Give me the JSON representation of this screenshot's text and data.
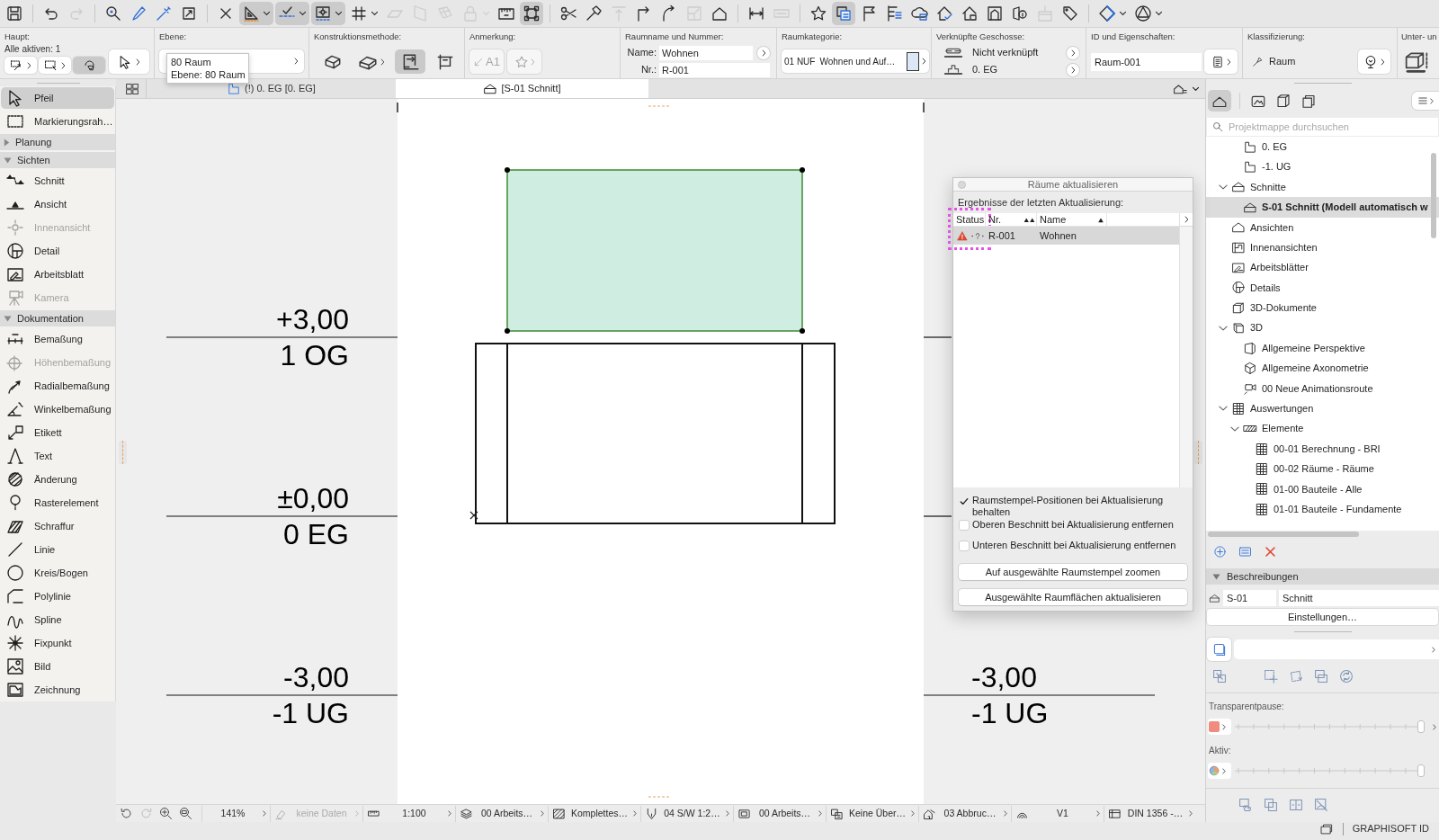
{
  "toolbar": [
    [
      {
        "kind": "save",
        "on": false,
        "menu": false,
        "disabled": false
      }
    ],
    [
      {
        "kind": "undo",
        "on": false,
        "menu": false,
        "disabled": false
      },
      {
        "kind": "redo",
        "on": false,
        "menu": false,
        "disabled": true
      }
    ],
    [
      {
        "kind": "find",
        "on": false,
        "menu": false,
        "disabled": false
      },
      {
        "kind": "eyedropper",
        "on": false,
        "menu": false,
        "disabled": false
      },
      {
        "kind": "syringe",
        "on": false,
        "menu": false,
        "disabled": false
      },
      {
        "kind": "transform",
        "on": false,
        "menu": false,
        "disabled": false
      }
    ],
    [
      {
        "kind": "snap",
        "on": false,
        "menu": false,
        "disabled": false
      },
      {
        "kind": "setsquare",
        "on": true,
        "menu": true,
        "disabled": false
      },
      {
        "kind": "guideline",
        "on": true,
        "menu": true,
        "disabled": false
      },
      {
        "kind": "coordinates",
        "on": true,
        "menu": true,
        "disabled": false
      },
      {
        "kind": "grid",
        "on": false,
        "menu": true,
        "disabled": false
      },
      {
        "kind": "plane",
        "on": false,
        "menu": false,
        "disabled": true
      },
      {
        "kind": "vplane",
        "on": false,
        "menu": false,
        "disabled": true
      },
      {
        "kind": "mesh",
        "on": false,
        "menu": false,
        "disabled": true
      },
      {
        "kind": "lock",
        "on": false,
        "menu": true,
        "disabled": true
      },
      {
        "kind": "ruler",
        "on": false,
        "menu": false,
        "disabled": false
      },
      {
        "kind": "group",
        "on": true,
        "menu": false,
        "disabled": false
      }
    ],
    [
      {
        "kind": "scissors",
        "on": false,
        "menu": false,
        "disabled": false
      },
      {
        "kind": "hammer",
        "on": false,
        "menu": false,
        "disabled": false
      },
      {
        "kind": "elevate",
        "on": false,
        "menu": false,
        "disabled": true
      },
      {
        "kind": "corner",
        "on": false,
        "menu": false,
        "disabled": false
      },
      {
        "kind": "arc",
        "on": false,
        "menu": false,
        "disabled": false
      },
      {
        "kind": "resize",
        "on": false,
        "menu": false,
        "disabled": true
      },
      {
        "kind": "house",
        "on": false,
        "menu": false,
        "disabled": false
      }
    ],
    [
      {
        "kind": "dimension",
        "on": false,
        "menu": false,
        "disabled": false
      },
      {
        "kind": "dimbox",
        "on": false,
        "menu": false,
        "disabled": true
      }
    ],
    [
      {
        "kind": "star",
        "on": false,
        "menu": false,
        "disabled": false
      },
      {
        "kind": "layers",
        "on": true,
        "menu": false,
        "disabled": false
      },
      {
        "kind": "flag",
        "on": false,
        "menu": false,
        "disabled": false
      },
      {
        "kind": "listtree",
        "on": false,
        "menu": false,
        "disabled": false
      },
      {
        "kind": "cloud",
        "on": false,
        "menu": false,
        "disabled": false
      },
      {
        "kind": "housecheck",
        "on": false,
        "menu": false,
        "disabled": false
      },
      {
        "kind": "houselock",
        "on": false,
        "menu": false,
        "disabled": false
      },
      {
        "kind": "picture",
        "on": false,
        "menu": false,
        "disabled": false
      },
      {
        "kind": "info",
        "on": false,
        "menu": false,
        "disabled": false
      },
      {
        "kind": "brush",
        "on": false,
        "menu": false,
        "disabled": true
      },
      {
        "kind": "tag",
        "on": false,
        "menu": false,
        "disabled": false
      }
    ],
    [
      {
        "kind": "diamond",
        "on": false,
        "menu": true,
        "disabled": false
      },
      {
        "kind": "trianglecircle",
        "on": false,
        "menu": true,
        "disabled": false
      }
    ]
  ],
  "info_box": {
    "main": {
      "label": "Haupt:",
      "status": "Alle aktiven: 1",
      "buttons": [
        {
          "kind": "select-arrows",
          "on": false,
          "menu": true
        },
        {
          "kind": "marquee-small",
          "on": false,
          "menu": true
        },
        {
          "kind": "rotate",
          "on": true,
          "menu": false
        },
        {
          "kind": "pointer",
          "on": false,
          "menu": true
        }
      ]
    },
    "layer": {
      "label": "Ebene:"
    },
    "construction": {
      "label": "Konstruktionsmethode:",
      "buttons": [
        {
          "kind": "slab",
          "on": false,
          "menu": false
        },
        {
          "kind": "wedge",
          "on": false,
          "menu": true
        },
        {
          "kind": "polygon",
          "on": true,
          "menu": false
        },
        {
          "kind": "rectangle",
          "on": false,
          "menu": false
        }
      ]
    },
    "annotation": {
      "label": "Anmerkung:",
      "buttons": [
        {
          "kind": "label",
          "text": "A1",
          "disabled": true,
          "menu": false
        },
        {
          "kind": "star",
          "disabled": true,
          "menu": true
        }
      ]
    },
    "room": {
      "label": "Raumname und Nummer:",
      "name_label": "Name:",
      "name": "Wohnen",
      "number_label": "Nr.:",
      "number": "R-001"
    },
    "category": {
      "label": "Raumkategorie:",
      "code": "01 NUF",
      "value": "Wohnen und Auf…",
      "color": "#dce8f5"
    },
    "linked_stories": {
      "label": "Verknüpfte Geschosse:",
      "rows": [
        {
          "kind": "link",
          "text": "Nicht verknüpft"
        },
        {
          "kind": "story",
          "text": "0. EG"
        }
      ]
    },
    "id": {
      "label": "ID und Eigenschaften:",
      "value": "Raum-001"
    },
    "classification": {
      "label": "Klassifizierung:",
      "value": "Raum"
    },
    "sub_elements": {
      "label": "Unter- un"
    }
  },
  "tooltip": {
    "lines": [
      "80 Raum",
      "Ebene: 80 Raum"
    ]
  },
  "tabs": [
    {
      "label": "(!) 0. EG [0. EG]",
      "kind": "story",
      "selected": false
    },
    {
      "label": "[S-01 Schnitt]",
      "kind": "section",
      "selected": true
    }
  ],
  "toolbox": {
    "tools": [
      {
        "kind": "arrow",
        "label": "Pfeil",
        "selected": true,
        "disabled": false
      },
      {
        "kind": "marquee",
        "label": "Markierungsrah…",
        "selected": false,
        "disabled": false
      }
    ],
    "groups": [
      {
        "label": "Planung",
        "expanded": false
      },
      {
        "label": "Sichten",
        "expanded": true,
        "tools": [
          {
            "kind": "section",
            "label": "Schnitt",
            "selected": false,
            "disabled": false
          },
          {
            "kind": "elevation",
            "label": "Ansicht",
            "selected": false,
            "disabled": false
          },
          {
            "kind": "interior",
            "label": "Innenansicht",
            "selected": false,
            "disabled": true
          },
          {
            "kind": "detail",
            "label": "Detail",
            "selected": false,
            "disabled": false
          },
          {
            "kind": "worksheet",
            "label": "Arbeitsblatt",
            "selected": false,
            "disabled": false
          },
          {
            "kind": "camera",
            "label": "Kamera",
            "selected": false,
            "disabled": true
          }
        ]
      },
      {
        "label": "Dokumentation",
        "expanded": true,
        "tools": [
          {
            "kind": "dimension",
            "label": "Bemaßung",
            "selected": false,
            "disabled": false
          },
          {
            "kind": "leveldim",
            "label": "Höhenbemaßung",
            "selected": false,
            "disabled": true
          },
          {
            "kind": "radial",
            "label": "Radialbemaßung",
            "selected": false,
            "disabled": false
          },
          {
            "kind": "angle",
            "label": "Winkelbemaßung",
            "selected": false,
            "disabled": false
          },
          {
            "kind": "label",
            "label": "Etikett",
            "selected": false,
            "disabled": false
          },
          {
            "kind": "text",
            "label": "Text",
            "selected": false,
            "disabled": false
          },
          {
            "kind": "change",
            "label": "Änderung",
            "selected": false,
            "disabled": false
          },
          {
            "kind": "gridpoint",
            "label": "Rasterelement",
            "selected": false,
            "disabled": false
          },
          {
            "kind": "hatch",
            "label": "Schraffur",
            "selected": false,
            "disabled": false
          },
          {
            "kind": "line",
            "label": "Linie",
            "selected": false,
            "disabled": false
          },
          {
            "kind": "circle",
            "label": "Kreis/Bogen",
            "selected": false,
            "disabled": false
          },
          {
            "kind": "polyline",
            "label": "Polylinie",
            "selected": false,
            "disabled": false
          },
          {
            "kind": "spline",
            "label": "Spline",
            "selected": false,
            "disabled": false
          },
          {
            "kind": "hotspot",
            "label": "Fixpunkt",
            "selected": false,
            "disabled": false
          },
          {
            "kind": "image",
            "label": "Bild",
            "selected": false,
            "disabled": false
          },
          {
            "kind": "drawing",
            "label": "Zeichnung",
            "selected": false,
            "disabled": false
          }
        ]
      }
    ]
  },
  "canvas": {
    "levels": [
      {
        "elevation": "+3,00",
        "name": "1 OG"
      },
      {
        "elevation": "±0,00",
        "name": "0 EG"
      },
      {
        "elevation": "-3,00",
        "name": "-1 UG",
        "right": {
          "elevation": "-3,00",
          "name": "-1 UG"
        }
      }
    ],
    "room": {
      "selected": true
    }
  },
  "dialog": {
    "title": "Räume aktualisieren",
    "subtitle": "Ergebnisse der letzten Aktualisierung:",
    "columns": [
      {
        "label": "Status",
        "kind": "plain",
        "highlighted": true
      },
      {
        "label": "Nr.",
        "kind": "double",
        "highlighted": false
      },
      {
        "label": "Name",
        "kind": "single",
        "highlighted": false
      }
    ],
    "rows": [
      {
        "warning": true,
        "number": "R-001",
        "name": "Wohnen",
        "selected": true
      }
    ],
    "options": [
      {
        "label": "Raumstempel-Positionen bei Aktualisierung behalten",
        "checked": true
      },
      {
        "label": "Oberen Beschnitt bei Aktualisierung entfernen",
        "checked": false
      },
      {
        "label": "Unteren Beschnitt bei Aktualisierung entfernen",
        "checked": false
      }
    ],
    "buttons": [
      "Auf ausgewählte Raumstempel zoomen",
      "Ausgewählte Raumflächen aktualisieren"
    ]
  },
  "navigator": {
    "views": [
      {
        "kind": "project",
        "selected": true
      },
      {
        "kind": "view",
        "selected": false
      },
      {
        "kind": "layout",
        "selected": false
      },
      {
        "kind": "publisher",
        "selected": false
      }
    ],
    "search": {
      "placeholder": "Projektmappe durchsuchen"
    },
    "tree": [
      {
        "children": [
          {
            "kind": "story",
            "label": "0. EG",
            "selected": false
          },
          {
            "kind": "story",
            "label": "-1. UG",
            "selected": false
          }
        ]
      },
      {
        "kind": "section",
        "label": "Schnitte",
        "selected": false,
        "expanded": true,
        "children": [
          {
            "kind": "section",
            "label": "S-01 Schnitt (Modell automatisch w",
            "selected": true
          }
        ]
      },
      {
        "kind": "elevation",
        "label": "Ansichten",
        "selected": false
      },
      {
        "kind": "interior",
        "label": "Innenansichten",
        "selected": false
      },
      {
        "kind": "worksheet",
        "label": "Arbeitsblätter",
        "selected": false
      },
      {
        "kind": "detail",
        "label": "Details",
        "selected": false
      },
      {
        "kind": "doc3d",
        "label": "3D-Dokumente",
        "selected": false
      },
      {
        "kind": "model3d",
        "label": "3D",
        "selected": false,
        "expanded": true,
        "children": [
          {
            "kind": "perspective",
            "label": "Allgemeine Perspektive",
            "selected": false
          },
          {
            "kind": "axonometry",
            "label": "Allgemeine Axonometrie",
            "selected": false
          },
          {
            "kind": "animation",
            "label": "00 Neue Animationsroute",
            "selected": false
          }
        ]
      },
      {
        "kind": "schedule",
        "label": "Auswertungen",
        "selected": false,
        "expanded": true,
        "children": [
          {
            "kind": "hatch",
            "label": "Elemente",
            "selected": false,
            "expanded": true,
            "children": [
              {
                "kind": "schedule",
                "label": "00-01 Berechnung - BRI",
                "selected": false
              },
              {
                "kind": "schedule",
                "label": "00-02 Räume - Räume",
                "selected": false
              },
              {
                "kind": "schedule",
                "label": "01-00 Bauteile - Alle",
                "selected": false
              },
              {
                "kind": "schedule",
                "label": "01-01 Bauteile - Fundamente",
                "selected": false
              }
            ]
          }
        ]
      }
    ],
    "actions": [
      {
        "kind": "add"
      },
      {
        "kind": "properties"
      },
      {
        "kind": "delete"
      }
    ],
    "description": {
      "header": "Beschreibungen",
      "expanded": true,
      "id": "S-01",
      "name": "Schnitt",
      "button": "Einstellungen…"
    },
    "layout_tools": [
      {
        "kind": "resize"
      },
      {
        "kind": "move"
      },
      {
        "kind": "rotate"
      },
      {
        "kind": "mirror"
      },
      {
        "kind": "refresh"
      }
    ],
    "sliders": [
      {
        "label": "Transparentpause:",
        "kind": "swatch",
        "level": 1,
        "menu": true
      },
      {
        "label": "Aktiv:",
        "kind": "pie",
        "level": 1,
        "menu": false
      }
    ],
    "bottom_tools": [
      {
        "kind": "hand"
      },
      {
        "kind": "overlap"
      },
      {
        "kind": "split"
      },
      {
        "kind": "hide"
      }
    ]
  },
  "status_bar": {
    "tools": [
      {
        "kind": "back",
        "disabled": false
      },
      {
        "kind": "forward",
        "disabled": true
      },
      {
        "kind": "zoomin",
        "disabled": false
      },
      {
        "kind": "zoomfit",
        "disabled": false
      }
    ],
    "items": [
      {
        "kind": "zoom",
        "text": "141%",
        "disabled": false
      },
      {
        "kind": "eraser",
        "text": "keine Daten",
        "disabled": true
      },
      {
        "kind": "scale",
        "text": "1:100",
        "disabled": false
      },
      {
        "kind": "layers",
        "text": "00 Arbeits…",
        "disabled": false
      },
      {
        "kind": "structure",
        "text": "Komplettes…",
        "disabled": false
      },
      {
        "kind": "pens",
        "text": "04 S/W 1:2…",
        "disabled": false
      },
      {
        "kind": "model",
        "text": "00 Arbeits…",
        "disabled": false
      },
      {
        "kind": "override",
        "text": "Keine Über…",
        "disabled": false
      },
      {
        "kind": "renovation",
        "text": "03 Abbruc…",
        "disabled": false
      },
      {
        "kind": "partial",
        "text": "V1",
        "disabled": false
      },
      {
        "kind": "dimensions",
        "text": "DIN 1356 -…",
        "disabled": false
      }
    ]
  },
  "footer": {
    "brand": "GRAPHISOFT ID"
  }
}
